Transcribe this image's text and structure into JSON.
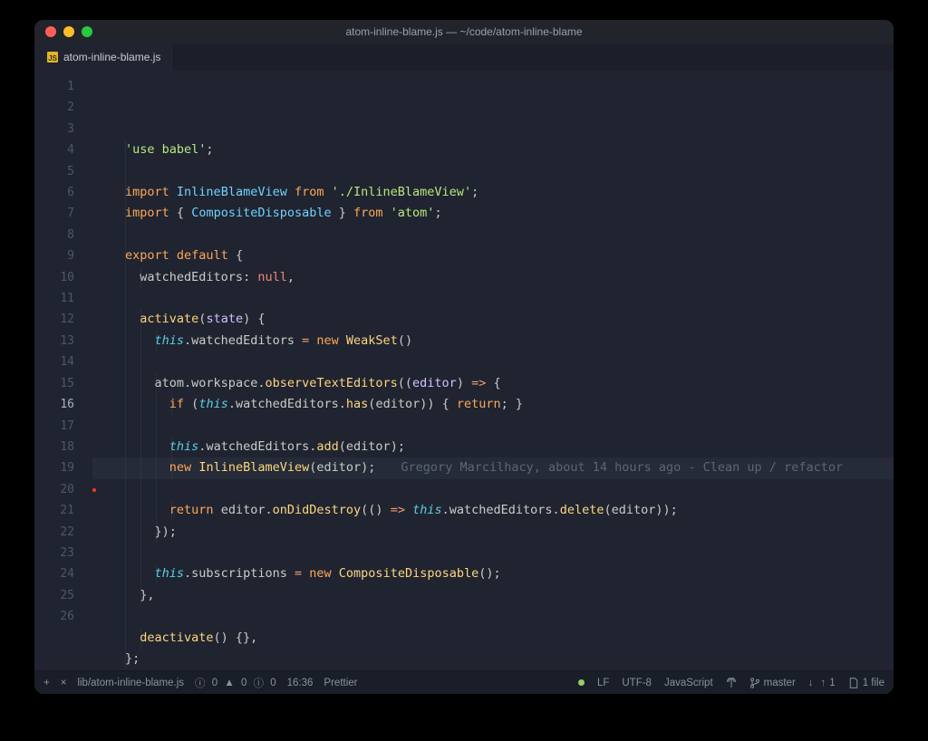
{
  "window": {
    "title": "atom-inline-blame.js — ~/code/atom-inline-blame"
  },
  "tab": {
    "filename": "atom-inline-blame.js"
  },
  "editor": {
    "line_count": 26,
    "highlighted_line": 16,
    "blame": {
      "author": "Gregory Marcilhacy",
      "time": "about 14 hours ago",
      "message": "Clean up / refactor"
    },
    "lines": {
      "l1": [
        [
          "c-str",
          "'use babel'"
        ],
        [
          "c-punc",
          ";"
        ]
      ],
      "l2": [],
      "l3": [
        [
          "c-key",
          "import"
        ],
        [
          "",
          " "
        ],
        [
          "c-cls",
          "InlineBlameView"
        ],
        [
          "",
          " "
        ],
        [
          "c-key",
          "from"
        ],
        [
          "",
          " "
        ],
        [
          "c-str",
          "'./InlineBlameView'"
        ],
        [
          "c-punc",
          ";"
        ]
      ],
      "l4": [
        [
          "c-key",
          "import"
        ],
        [
          "",
          " "
        ],
        [
          "c-punc",
          "{ "
        ],
        [
          "c-cls",
          "CompositeDisposable"
        ],
        [
          "c-punc",
          " } "
        ],
        [
          "c-key",
          "from"
        ],
        [
          "",
          " "
        ],
        [
          "c-str",
          "'atom'"
        ],
        [
          "c-punc",
          ";"
        ]
      ],
      "l5": [],
      "l6": [
        [
          "c-key",
          "export"
        ],
        [
          "",
          " "
        ],
        [
          "c-key",
          "default"
        ],
        [
          "",
          " "
        ],
        [
          "c-punc",
          "{"
        ]
      ],
      "l7": [
        [
          "",
          "  "
        ],
        [
          "c-prop",
          "watchedEditors"
        ],
        [
          "c-punc",
          ": "
        ],
        [
          "c-const",
          "null"
        ],
        [
          "c-punc",
          ","
        ]
      ],
      "l8": [],
      "l9": [
        [
          "",
          "  "
        ],
        [
          "c-fn",
          "activate"
        ],
        [
          "c-punc",
          "("
        ],
        [
          "c-param",
          "state"
        ],
        [
          "c-punc",
          ") {"
        ]
      ],
      "l10": [
        [
          "",
          "    "
        ],
        [
          "c-this",
          "this"
        ],
        [
          "c-punc",
          "."
        ],
        [
          "c-prop",
          "watchedEditors"
        ],
        [
          "",
          " "
        ],
        [
          "c-op",
          "="
        ],
        [
          "",
          " "
        ],
        [
          "c-key",
          "new"
        ],
        [
          "",
          " "
        ],
        [
          "c-fn",
          "WeakSet"
        ],
        [
          "c-punc",
          "()"
        ]
      ],
      "l11": [],
      "l12": [
        [
          "",
          "    "
        ],
        [
          "c-prop",
          "atom"
        ],
        [
          "c-punc",
          "."
        ],
        [
          "c-prop",
          "workspace"
        ],
        [
          "c-punc",
          "."
        ],
        [
          "c-fn",
          "observeTextEditors"
        ],
        [
          "c-punc",
          "(("
        ],
        [
          "c-param",
          "editor"
        ],
        [
          "c-punc",
          ") "
        ],
        [
          "c-op",
          "=>"
        ],
        [
          "c-punc",
          " {"
        ]
      ],
      "l13": [
        [
          "",
          "      "
        ],
        [
          "c-key",
          "if"
        ],
        [
          "c-punc",
          " ("
        ],
        [
          "c-this",
          "this"
        ],
        [
          "c-punc",
          "."
        ],
        [
          "c-prop",
          "watchedEditors"
        ],
        [
          "c-punc",
          "."
        ],
        [
          "c-fn",
          "has"
        ],
        [
          "c-punc",
          "("
        ],
        [
          "c-prop",
          "editor"
        ],
        [
          "c-punc",
          ")) { "
        ],
        [
          "c-key",
          "return"
        ],
        [
          "c-punc",
          "; }"
        ]
      ],
      "l14": [],
      "l15": [
        [
          "",
          "      "
        ],
        [
          "c-this",
          "this"
        ],
        [
          "c-punc",
          "."
        ],
        [
          "c-prop",
          "watchedEditors"
        ],
        [
          "c-punc",
          "."
        ],
        [
          "c-fn",
          "add"
        ],
        [
          "c-punc",
          "("
        ],
        [
          "c-prop",
          "editor"
        ],
        [
          "c-punc",
          ");"
        ]
      ],
      "l16": [
        [
          "",
          "      "
        ],
        [
          "c-key",
          "new"
        ],
        [
          "",
          " "
        ],
        [
          "c-fn",
          "InlineBlameView"
        ],
        [
          "c-punc",
          "("
        ],
        [
          "c-prop",
          "editor"
        ],
        [
          "c-punc",
          ");"
        ]
      ],
      "l17": [],
      "l18": [
        [
          "",
          "      "
        ],
        [
          "c-key",
          "return"
        ],
        [
          "",
          " "
        ],
        [
          "c-prop",
          "editor"
        ],
        [
          "c-punc",
          "."
        ],
        [
          "c-fn",
          "onDidDestroy"
        ],
        [
          "c-punc",
          "(() "
        ],
        [
          "c-op",
          "=>"
        ],
        [
          "c-punc",
          " "
        ],
        [
          "c-this",
          "this"
        ],
        [
          "c-punc",
          "."
        ],
        [
          "c-prop",
          "watchedEditors"
        ],
        [
          "c-punc",
          "."
        ],
        [
          "c-fn",
          "delete"
        ],
        [
          "c-punc",
          "("
        ],
        [
          "c-prop",
          "editor"
        ],
        [
          "c-punc",
          "));"
        ]
      ],
      "l19": [
        [
          "",
          "    "
        ],
        [
          "c-punc",
          "});"
        ]
      ],
      "l20": [],
      "l21": [
        [
          "",
          "    "
        ],
        [
          "c-this",
          "this"
        ],
        [
          "c-punc",
          "."
        ],
        [
          "c-prop",
          "subscriptions"
        ],
        [
          "",
          " "
        ],
        [
          "c-op",
          "="
        ],
        [
          "",
          " "
        ],
        [
          "c-key",
          "new"
        ],
        [
          "",
          " "
        ],
        [
          "c-fn",
          "CompositeDisposable"
        ],
        [
          "c-punc",
          "();"
        ]
      ],
      "l22": [
        [
          "",
          "  "
        ],
        [
          "c-punc",
          "},"
        ]
      ],
      "l23": [],
      "l24": [
        [
          "",
          "  "
        ],
        [
          "c-fn",
          "deactivate"
        ],
        [
          "c-punc",
          "() {},"
        ]
      ],
      "l25": [
        [
          "c-punc",
          "};"
        ]
      ],
      "l26": []
    },
    "indent_guides": {
      "1": [
        0
      ],
      "2": [
        0
      ],
      "3": [
        0
      ],
      "4": [
        0
      ],
      "5": [
        0
      ],
      "6": [
        0
      ],
      "7": [
        0,
        1
      ],
      "8": [
        0
      ],
      "9": [
        0,
        1
      ],
      "10": [
        0,
        1,
        2
      ],
      "11": [
        0,
        1
      ],
      "12": [
        0,
        1,
        2
      ],
      "13": [
        0,
        1,
        2,
        3
      ],
      "14": [
        0,
        1,
        2
      ],
      "15": [
        0,
        1,
        2,
        3
      ],
      "16": [
        0,
        1,
        2,
        3
      ],
      "17": [
        0,
        1,
        2
      ],
      "18": [
        0,
        1,
        2,
        3
      ],
      "19": [
        0,
        1,
        2
      ],
      "20": [
        0,
        1
      ],
      "21": [
        0,
        1,
        2
      ],
      "22": [
        0,
        1
      ],
      "23": [
        0
      ],
      "24": [
        0,
        1
      ],
      "25": [
        0
      ],
      "26": []
    }
  },
  "status": {
    "path": "lib/atom-inline-blame.js",
    "diagnostics": {
      "info": 0,
      "warn": 0,
      "error": 0
    },
    "cursor": "16:36",
    "formatter": "Prettier",
    "line_ending": "LF",
    "encoding": "UTF-8",
    "language": "JavaScript",
    "branch": "master",
    "git_behind": "",
    "git_ahead": "1",
    "files": "1 file"
  },
  "icons": {
    "plus": "+",
    "close": "×",
    "branch": "⎇",
    "arrow_down": "↓",
    "arrow_up": "↑",
    "file": "🗎"
  }
}
